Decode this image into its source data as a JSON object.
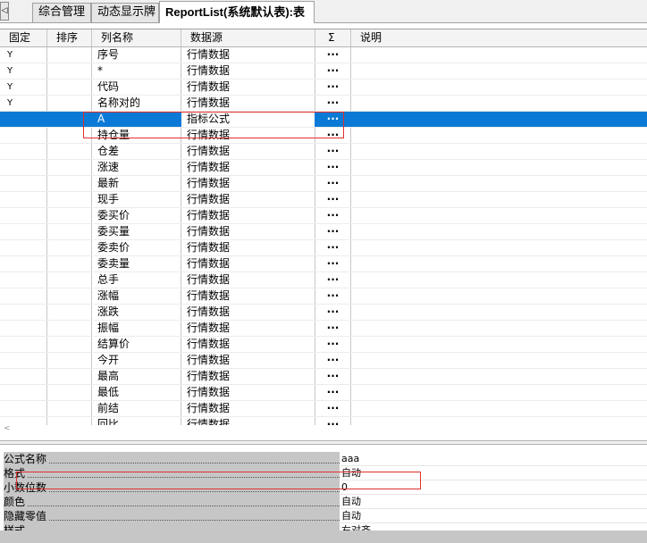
{
  "tabs": [
    {
      "label": "综合管理",
      "active": false
    },
    {
      "label": "动态显示牌",
      "active": false
    },
    {
      "label": "ReportList(系统默认表):表",
      "active": true
    }
  ],
  "tab_scroll_glyph": "◁",
  "columns": [
    "固定",
    "排序",
    "列名称",
    "数据源",
    "Σ",
    "说明"
  ],
  "rows": [
    {
      "fixed": "Y",
      "sort": "",
      "name": "序号",
      "source": "行情数据",
      "sum": "···",
      "desc": ""
    },
    {
      "fixed": "Y",
      "sort": "",
      "name": "*",
      "source": "行情数据",
      "sum": "···",
      "desc": ""
    },
    {
      "fixed": "Y",
      "sort": "",
      "name": "代码",
      "source": "行情数据",
      "sum": "···",
      "desc": ""
    },
    {
      "fixed": "Y",
      "sort": "",
      "name": "名称对的",
      "source": "行情数据",
      "sum": "···",
      "desc": ""
    },
    {
      "fixed": "",
      "sort": "",
      "name": "A",
      "source": "指标公式",
      "sum": "···",
      "desc": "",
      "selected": true
    },
    {
      "fixed": "",
      "sort": "",
      "name": "持仓量",
      "source": "行情数据",
      "sum": "···",
      "desc": ""
    },
    {
      "fixed": "",
      "sort": "",
      "name": "仓差",
      "source": "行情数据",
      "sum": "···",
      "desc": ""
    },
    {
      "fixed": "",
      "sort": "",
      "name": "涨速",
      "source": "行情数据",
      "sum": "···",
      "desc": ""
    },
    {
      "fixed": "",
      "sort": "",
      "name": "最新",
      "source": "行情数据",
      "sum": "···",
      "desc": ""
    },
    {
      "fixed": "",
      "sort": "",
      "name": "现手",
      "source": "行情数据",
      "sum": "···",
      "desc": ""
    },
    {
      "fixed": "",
      "sort": "",
      "name": "委买价",
      "source": "行情数据",
      "sum": "···",
      "desc": ""
    },
    {
      "fixed": "",
      "sort": "",
      "name": "委买量",
      "source": "行情数据",
      "sum": "···",
      "desc": ""
    },
    {
      "fixed": "",
      "sort": "",
      "name": "委卖价",
      "source": "行情数据",
      "sum": "···",
      "desc": ""
    },
    {
      "fixed": "",
      "sort": "",
      "name": "委卖量",
      "source": "行情数据",
      "sum": "···",
      "desc": ""
    },
    {
      "fixed": "",
      "sort": "",
      "name": "总手",
      "source": "行情数据",
      "sum": "···",
      "desc": ""
    },
    {
      "fixed": "",
      "sort": "",
      "name": "涨幅",
      "source": "行情数据",
      "sum": "···",
      "desc": ""
    },
    {
      "fixed": "",
      "sort": "",
      "name": "涨跌",
      "source": "行情数据",
      "sum": "···",
      "desc": ""
    },
    {
      "fixed": "",
      "sort": "",
      "name": "振幅",
      "source": "行情数据",
      "sum": "···",
      "desc": ""
    },
    {
      "fixed": "",
      "sort": "",
      "name": "结算价",
      "source": "行情数据",
      "sum": "···",
      "desc": ""
    },
    {
      "fixed": "",
      "sort": "",
      "name": "今开",
      "source": "行情数据",
      "sum": "···",
      "desc": ""
    },
    {
      "fixed": "",
      "sort": "",
      "name": "最高",
      "source": "行情数据",
      "sum": "···",
      "desc": ""
    },
    {
      "fixed": "",
      "sort": "",
      "name": "最低",
      "source": "行情数据",
      "sum": "···",
      "desc": ""
    },
    {
      "fixed": "",
      "sort": "",
      "name": "前结",
      "source": "行情数据",
      "sum": "···",
      "desc": ""
    },
    {
      "fixed": "",
      "sort": "",
      "name": "回比",
      "source": "行情数据",
      "sum": "···",
      "desc": ""
    }
  ],
  "hscroll_glyph": "<",
  "properties": [
    {
      "name": "公式名称",
      "value": "aaa"
    },
    {
      "name": "格式",
      "value": "自动"
    },
    {
      "name": "小数位数",
      "value": "0"
    },
    {
      "name": "颜色",
      "value": "自动"
    },
    {
      "name": "隐藏零值",
      "value": "自动"
    },
    {
      "name": "样式",
      "value": "右对齐"
    }
  ],
  "colors": {
    "selection": "#0a7ad6",
    "annotation": "#e03030",
    "prop_label_bg": "#c6c6c6"
  }
}
